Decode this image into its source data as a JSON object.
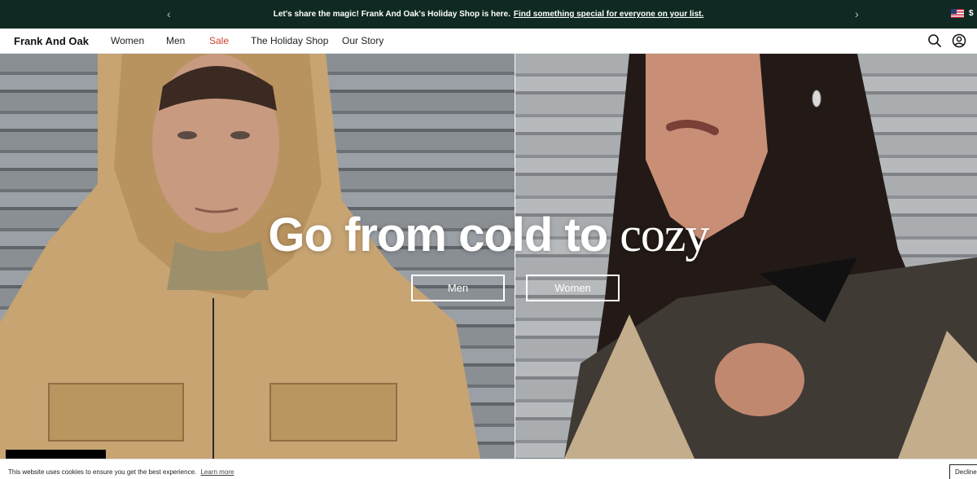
{
  "announcement": {
    "message": "Let's share the magic! Frank And Oak's Holiday Shop is here.",
    "link_text": "Find something special for everyone on your list.",
    "prev_icon": "chevron-left",
    "next_icon": "chevron-right",
    "currency": "$",
    "flag": "us-flag"
  },
  "nav": {
    "logo": "Frank And Oak",
    "links": [
      {
        "label": "Women"
      },
      {
        "label": "Men"
      },
      {
        "label": "Sale",
        "color": "#d0432c"
      },
      {
        "label": "The Holiday Shop"
      },
      {
        "label": "Our Story"
      }
    ],
    "icons": [
      "search-icon",
      "account-icon"
    ]
  },
  "hero": {
    "title_part1": "Go from cold to",
    "title_part2": "cozy",
    "buttons": [
      {
        "label": "Men"
      },
      {
        "label": "Women"
      }
    ]
  },
  "cookie_banner": {
    "text": "This website uses cookies to ensure you get the best experience.",
    "learn_more": "Learn more",
    "decline": "Decline"
  },
  "colors": {
    "announcement_bg": "#0f2a22",
    "sale": "#d0432c",
    "text": "#1a1a1a"
  }
}
